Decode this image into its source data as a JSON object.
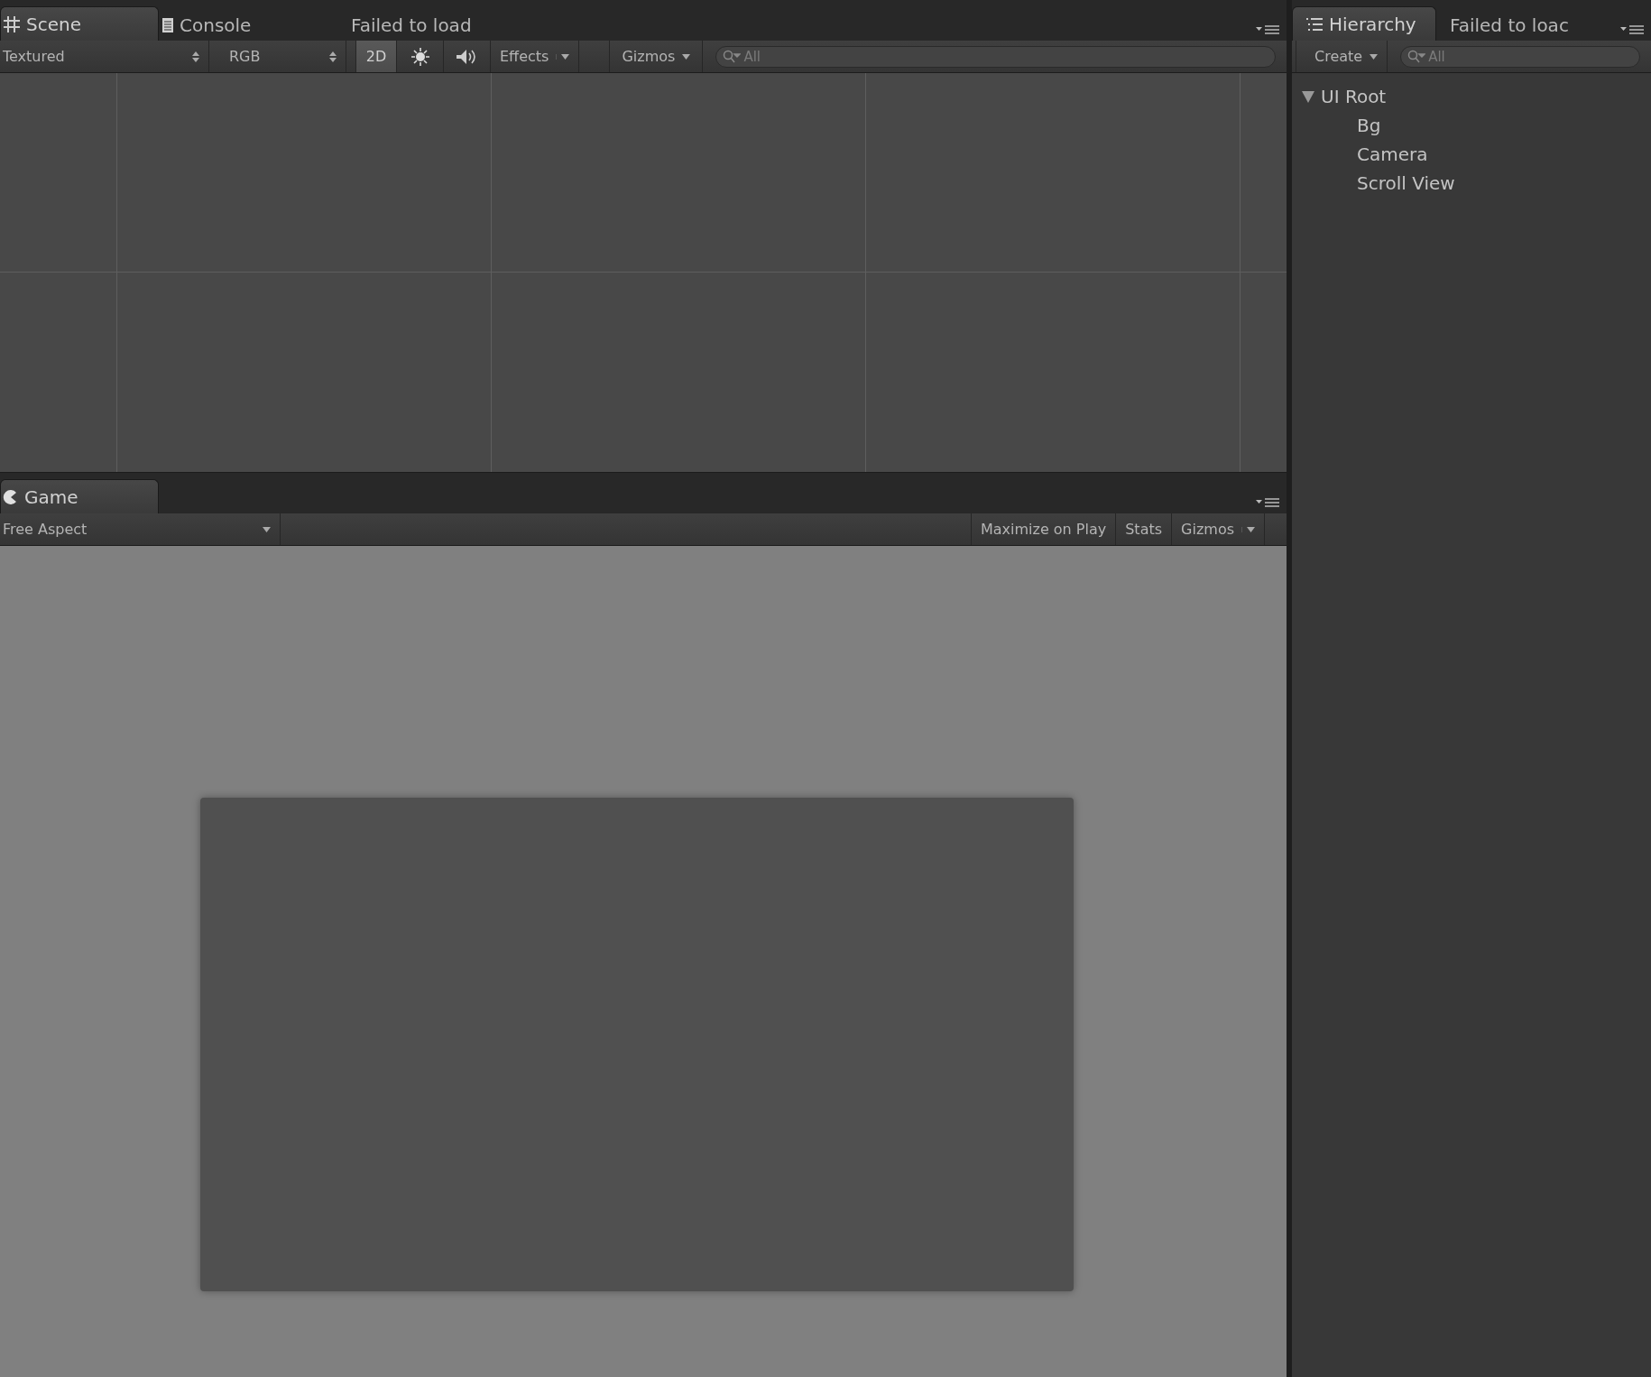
{
  "scene_panel": {
    "tabs": [
      {
        "label": "Scene",
        "kind": "grid",
        "selected": true
      },
      {
        "label": "Console",
        "kind": "document",
        "selected": false
      },
      {
        "label": "Failed to load",
        "kind": "plain",
        "selected": false
      }
    ],
    "toolbar": {
      "draw_mode": "Textured",
      "channel": "RGB",
      "toggle_2d": {
        "label": "2D",
        "on": true
      },
      "lighting_on": false,
      "audio_on": false,
      "effects": "Effects",
      "gizmos": "Gizmos",
      "search": {
        "placeholder": "All"
      }
    }
  },
  "game_panel": {
    "tabs": [
      {
        "label": "Game",
        "kind": "pacman",
        "selected": true
      }
    ],
    "toolbar": {
      "aspect": "Free Aspect",
      "buttons": [
        {
          "label": "Maximize on Play",
          "on": false
        },
        {
          "label": "Stats",
          "on": false
        }
      ],
      "gizmos": "Gizmos"
    }
  },
  "hierarchy_panel": {
    "tabs": [
      {
        "label": "Hierarchy",
        "kind": "list",
        "selected": true
      },
      {
        "label": "Failed to loac",
        "kind": "plain",
        "selected": false
      }
    ],
    "create": "Create",
    "search": {
      "placeholder": "All"
    },
    "tree": [
      {
        "label": "UI Root",
        "expanded": true,
        "children": [
          {
            "label": "Bg"
          },
          {
            "label": "Camera"
          },
          {
            "label": "Scroll View"
          }
        ]
      }
    ]
  }
}
